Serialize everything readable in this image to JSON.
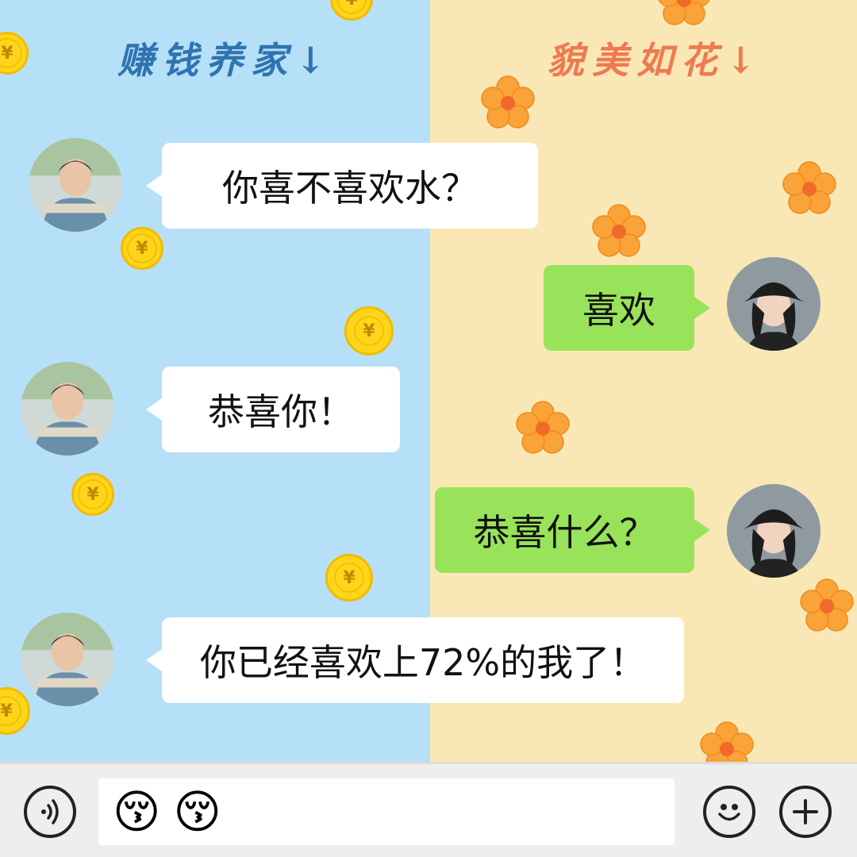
{
  "header": {
    "left_title": "赚钱养家↓",
    "right_title": "貌美如花↓"
  },
  "colors": {
    "left_bg": "#b6e0f8",
    "right_bg": "#f9e8b5",
    "bubble_left": "#ffffff",
    "bubble_right": "#99e35b",
    "left_title": "#2f74b0",
    "right_title": "#ee7a52"
  },
  "messages": [
    {
      "side": "left",
      "sender": "boy",
      "text": "你喜不喜欢水？"
    },
    {
      "side": "right",
      "sender": "girl",
      "text": "喜欢"
    },
    {
      "side": "left",
      "sender": "boy",
      "text": "恭喜你！"
    },
    {
      "side": "right",
      "sender": "girl",
      "text": "恭喜什么？"
    },
    {
      "side": "left",
      "sender": "boy",
      "text": "你已经喜欢上72%的我了！"
    }
  ],
  "decorations": {
    "coin_symbol": "¥",
    "coin_icon": "yuan-coin-icon",
    "flower_icon": "orange-flower-icon"
  },
  "input_bar": {
    "voice_icon": "voice-icon",
    "emoji_icon": "smiley-icon",
    "add_icon": "plus-icon",
    "draft_emojis": [
      "😚",
      "😚"
    ]
  }
}
